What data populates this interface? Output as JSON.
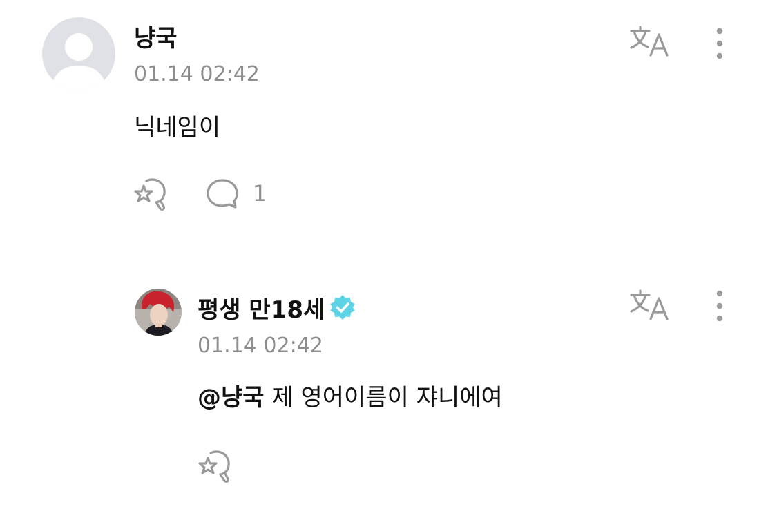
{
  "comments": [
    {
      "username": "냥국",
      "timestamp": "01.14 02:42",
      "text": "닉네임이",
      "reply_count": "1",
      "avatar": "default-avatar",
      "verified": false
    }
  ],
  "reply": {
    "username": "평생 만18세",
    "verified": true,
    "timestamp": "01.14 02:42",
    "mention": "@냥국",
    "text": " 제 영어이름이 쟈니에여",
    "avatar": "profile-photo"
  },
  "colors": {
    "text_primary": "#111111",
    "text_secondary": "#8e8e8e",
    "icon_gray": "#9a9a9a",
    "verified_badge": "#5fd3e6",
    "avatar_placeholder_bg": "#dfe1e6"
  },
  "icons": {
    "translate": "translate-icon",
    "more": "more-vertical-icon",
    "react": "sticker-react-icon",
    "reply": "speech-bubble-icon",
    "verified": "verified-badge-icon"
  }
}
